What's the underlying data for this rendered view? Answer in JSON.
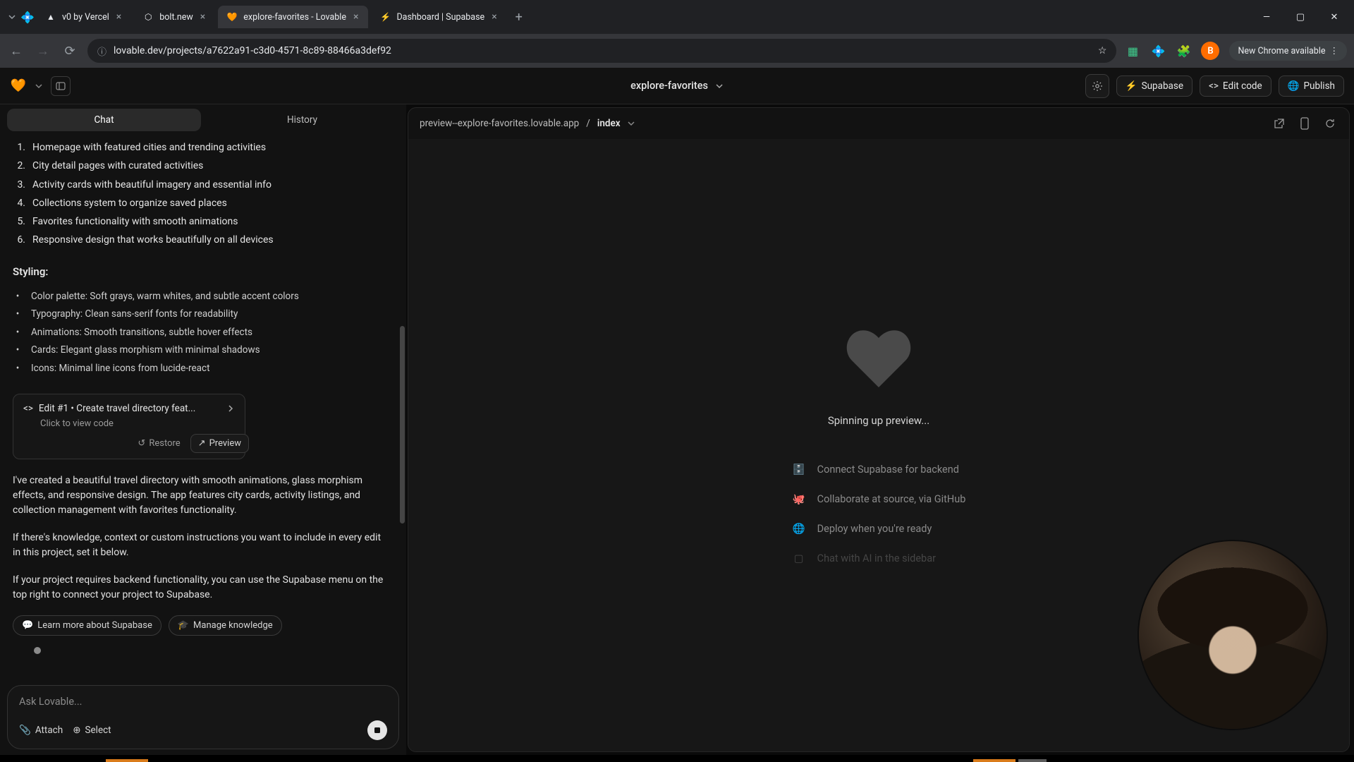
{
  "browser": {
    "tabs": [
      {
        "title": "v0 by Vercel",
        "favicon": "◆"
      },
      {
        "title": "bolt.new",
        "favicon": "⬣"
      },
      {
        "title": "explore-favorites - Lovable",
        "favicon": "🧡",
        "active": true
      },
      {
        "title": "Dashboard | Supabase",
        "favicon": "⚡"
      }
    ],
    "url": "lovable.dev/projects/a7622a91-c3d0-4571-8c89-88466a3def92",
    "update_button": "New Chrome available",
    "profile_initial": "B"
  },
  "header": {
    "project_name": "explore-favorites",
    "buttons": {
      "supabase": "Supabase",
      "edit_code": "Edit code",
      "publish": "Publish"
    }
  },
  "sidebar": {
    "tabs": {
      "chat": "Chat",
      "history": "History"
    },
    "features": [
      "Homepage with featured cities and trending activities",
      "City detail pages with curated activities",
      "Activity cards with beautiful imagery and essential info",
      "Collections system to organize saved places",
      "Favorites functionality with smooth animations",
      "Responsive design that works beautifully on all devices"
    ],
    "styling_heading": "Styling:",
    "styling": [
      "Color palette: Soft grays, warm whites, and subtle accent colors",
      "Typography: Clean sans-serif fonts for readability",
      "Animations: Smooth transitions, subtle hover effects",
      "Cards: Elegant glass morphism with minimal shadows",
      "Icons: Minimal line icons from lucide-react"
    ],
    "edit_card": {
      "title": "Edit #1 • Create travel directory feat...",
      "subtitle": "Click to view code",
      "restore": "Restore",
      "preview": "Preview"
    },
    "paragraphs": {
      "p1": "I've created a beautiful travel directory with smooth animations, glass morphism effects, and responsive design. The app features city cards, activity listings, and collection management with favorites functionality.",
      "p2": "If there's knowledge, context or custom instructions you want to include in every edit in this project, set it below.",
      "p3": "If your project requires backend functionality, you can use the Supabase menu on the top right to connect your project to Supabase."
    },
    "chips": {
      "learn": "Learn more about Supabase",
      "manage": "Manage knowledge"
    },
    "composer": {
      "placeholder": "Ask Lovable...",
      "attach": "Attach",
      "select": "Select"
    }
  },
  "preview": {
    "breadcrumb_host": "preview--explore-favorites.lovable.app",
    "breadcrumb_page": "index",
    "spinning": "Spinning up preview...",
    "hints": {
      "supabase": "Connect Supabase for backend",
      "github": "Collaborate at source, via GitHub",
      "deploy": "Deploy when you're ready",
      "chat": "Chat with AI in the sidebar"
    }
  }
}
